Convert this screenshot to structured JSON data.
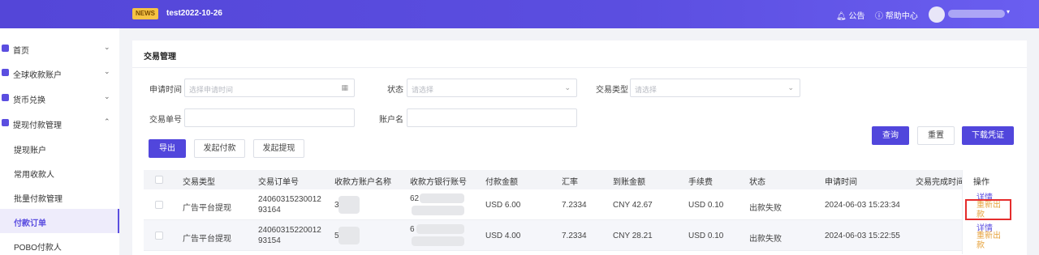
{
  "topbar": {
    "badge": "NEWS",
    "title": "test2022-10-26",
    "notice": "公告",
    "help": "帮助中心",
    "user_caret": "▾"
  },
  "sidebar": {
    "items": [
      {
        "label": "首页",
        "chev": "⌄"
      },
      {
        "label": "全球收款账户",
        "chev": "⌄"
      },
      {
        "label": "货币兑换",
        "chev": "⌄"
      },
      {
        "label": "提现付款管理",
        "chev": "⌃"
      }
    ],
    "sub_items": [
      {
        "label": "提现账户"
      },
      {
        "label": "常用收款人"
      },
      {
        "label": "批量付款管理"
      },
      {
        "label": "付款订单"
      },
      {
        "label": "POBO付款人"
      }
    ]
  },
  "page": {
    "title": "交易管理"
  },
  "filters": {
    "apply_time_label": "申请时间",
    "apply_time_placeholder": "选择申请时间",
    "status_label": "状态",
    "status_placeholder": "请选择",
    "type_label": "交易类型",
    "type_placeholder": "请选择",
    "order_no_label": "交易单号",
    "account_name_label": "账户名"
  },
  "buttons": {
    "export": "导出",
    "initiate_payment": "发起付款",
    "initiate_withdraw": "发起提现",
    "search": "查询",
    "reset": "重置",
    "download": "下载凭证"
  },
  "table": {
    "headers": [
      "交易类型",
      "交易订单号",
      "收款方账户名称",
      "收款方银行账号",
      "付款金额",
      "汇率",
      "到账金额",
      "手续费",
      "状态",
      "申请时间",
      "交易完成时间",
      "操作"
    ],
    "rows": [
      {
        "type": "广告平台提现",
        "order_no_1": "24060315230012",
        "order_no_2": "93164",
        "account_prefix": "3",
        "bank_prefix": "62",
        "amount": "USD 6.00",
        "rate": "7.2334",
        "received": "CNY 42.67",
        "fee": "USD 0.10",
        "status": "出款失败",
        "apply_time": "2024-06-03 15:23:34",
        "complete_time": "",
        "op_detail": "详情",
        "op_retry": "重新出款"
      },
      {
        "type": "广告平台提现",
        "order_no_1": "24060315220012",
        "order_no_2": "93154",
        "account_prefix": "5",
        "bank_prefix": "6",
        "amount": "USD 4.00",
        "rate": "7.2334",
        "received": "CNY 28.21",
        "fee": "USD 0.10",
        "status": "出款失败",
        "apply_time": "2024-06-03 15:22:55",
        "complete_time": "",
        "op_detail": "详情",
        "op_retry": "重新出款"
      }
    ]
  },
  "colors": {
    "primary": "#5146dc",
    "warning": "#e6a23c",
    "highlight": "#e52d2d"
  }
}
